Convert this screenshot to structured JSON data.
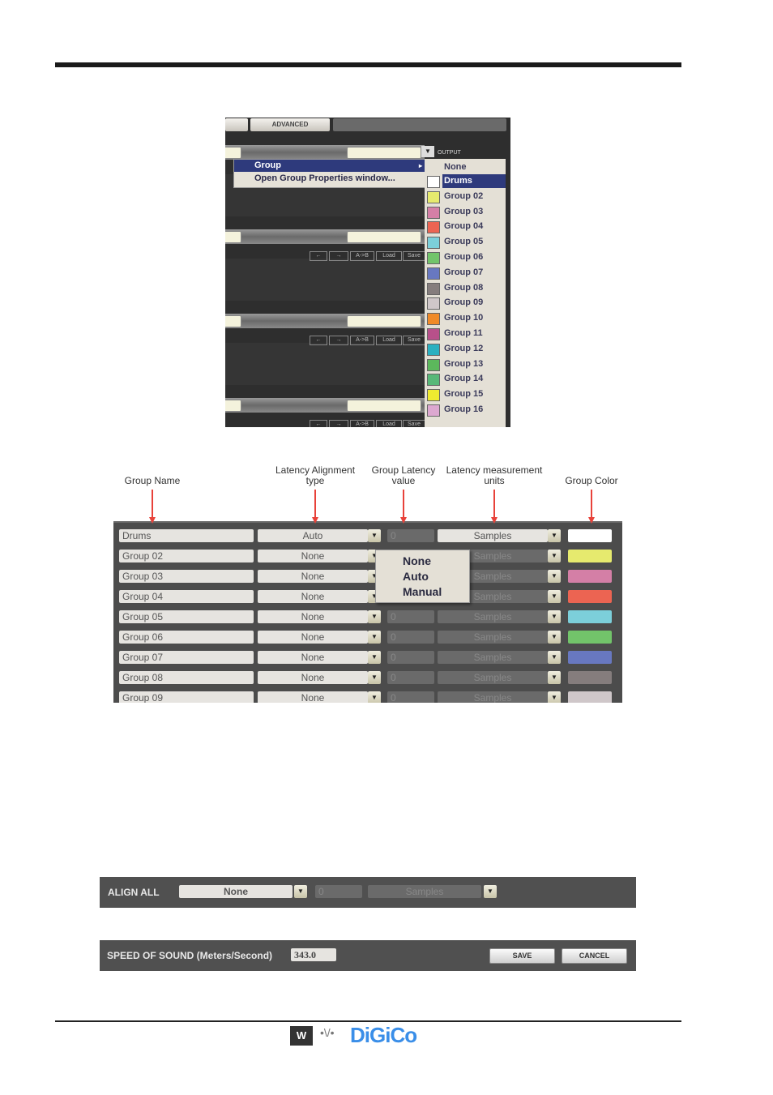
{
  "shot1": {
    "tabs": [
      "ADVANCED"
    ],
    "output_label": "OUTPUT",
    "context_menu": {
      "items": [
        "Group",
        "Open Group Properties window..."
      ]
    },
    "buttons": [
      "←",
      "→",
      "A->B",
      "Load",
      "Save"
    ],
    "group_list": [
      {
        "label": "None",
        "color": null
      },
      {
        "label": "Drums",
        "color": "#ffffff",
        "selected": true
      },
      {
        "label": "Group 02",
        "color": "#e6ea6e"
      },
      {
        "label": "Group 03",
        "color": "#d47fa6"
      },
      {
        "label": "Group 04",
        "color": "#ec6452"
      },
      {
        "label": "Group 05",
        "color": "#7ccfda"
      },
      {
        "label": "Group 06",
        "color": "#72c46a"
      },
      {
        "label": "Group 07",
        "color": "#6878c0"
      },
      {
        "label": "Group 08",
        "color": "#857d7d"
      },
      {
        "label": "Group 09",
        "color": "#cfc7c9"
      },
      {
        "label": "Group 10",
        "color": "#f08a28"
      },
      {
        "label": "Group 11",
        "color": "#b8508a"
      },
      {
        "label": "Group 12",
        "color": "#2ab0c0"
      },
      {
        "label": "Group 13",
        "color": "#5cb85c"
      },
      {
        "label": "Group 14",
        "color": "#58b878"
      },
      {
        "label": "Group 15",
        "color": "#eeea30"
      },
      {
        "label": "Group 16",
        "color": "#dca8d0"
      }
    ]
  },
  "headers": {
    "name": "Group Name",
    "type": "Latency Alignment type",
    "value": "Group Latency value",
    "units": "Latency measurement units",
    "color": "Group Color"
  },
  "rows": [
    {
      "name": "Drums",
      "type": "Auto",
      "value": "0",
      "units": "Samples",
      "color": "#ffffff",
      "active": true
    },
    {
      "name": "Group 02",
      "type": "None",
      "value": "0",
      "units": "Samples",
      "color": "#e6ea6e"
    },
    {
      "name": "Group 03",
      "type": "None",
      "value": "0",
      "units": "Samples",
      "color": "#d47fa6"
    },
    {
      "name": "Group 04",
      "type": "None",
      "value": "0",
      "units": "Samples",
      "color": "#ec6452"
    },
    {
      "name": "Group 05",
      "type": "None",
      "value": "0",
      "units": "Samples",
      "color": "#7ccfda"
    },
    {
      "name": "Group 06",
      "type": "None",
      "value": "0",
      "units": "Samples",
      "color": "#72c46a"
    },
    {
      "name": "Group 07",
      "type": "None",
      "value": "0",
      "units": "Samples",
      "color": "#6878c0"
    },
    {
      "name": "Group 08",
      "type": "None",
      "value": "0",
      "units": "Samples",
      "color": "#857d7d"
    },
    {
      "name": "Group 09",
      "type": "None",
      "value": "0",
      "units": "Samples",
      "color": "#cfc7c9"
    }
  ],
  "type_popup": [
    "None",
    "Auto",
    "Manual"
  ],
  "align_all": {
    "label": "ALIGN ALL",
    "type": "None",
    "value": "0",
    "units": "Samples"
  },
  "speed": {
    "label": "SPEED OF SOUND (Meters/Second)",
    "value": "343.0",
    "save": "SAVE",
    "cancel": "CANCEL"
  },
  "logo": {
    "text": "DiGiCo"
  }
}
